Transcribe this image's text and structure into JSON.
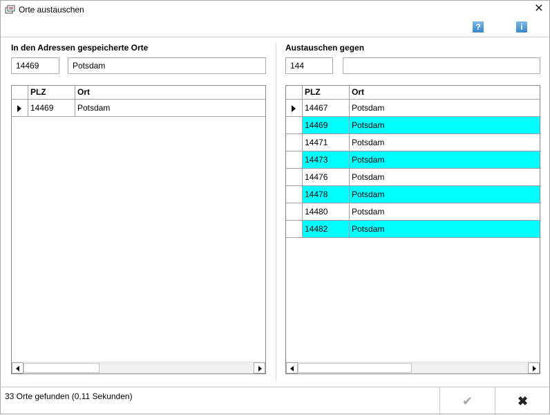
{
  "window": {
    "title": "Orte austauschen"
  },
  "left": {
    "label": "In den Adressen gespeicherte Orte",
    "plz_value": "14469",
    "ort_value": "Potsdam",
    "columns": [
      "PLZ",
      "Ort"
    ],
    "rows": [
      {
        "plz": "14469",
        "ort": "Potsdam",
        "current": true,
        "highlight": false
      }
    ]
  },
  "right": {
    "label": "Austauschen gegen",
    "plz_value": "144",
    "ort_value": "",
    "columns": [
      "PLZ",
      "Ort"
    ],
    "rows": [
      {
        "plz": "14467",
        "ort": "Potsdam",
        "current": true,
        "highlight": false
      },
      {
        "plz": "14469",
        "ort": "Potsdam",
        "current": false,
        "highlight": true
      },
      {
        "plz": "14471",
        "ort": "Potsdam",
        "current": false,
        "highlight": false
      },
      {
        "plz": "14473",
        "ort": "Potsdam",
        "current": false,
        "highlight": true
      },
      {
        "plz": "14476",
        "ort": "Potsdam",
        "current": false,
        "highlight": false
      },
      {
        "plz": "14478",
        "ort": "Potsdam",
        "current": false,
        "highlight": true
      },
      {
        "plz": "14480",
        "ort": "Potsdam",
        "current": false,
        "highlight": false
      },
      {
        "plz": "14482",
        "ort": "Potsdam",
        "current": false,
        "highlight": true
      }
    ]
  },
  "status": {
    "text": "33 Orte gefunden (0,11 Sekunden)"
  },
  "buttons": {
    "ok": "✔",
    "cancel": "✖"
  },
  "icons": {
    "help": "?",
    "info": "i",
    "close": "✕"
  },
  "colors": {
    "highlight": "#00ffff"
  }
}
